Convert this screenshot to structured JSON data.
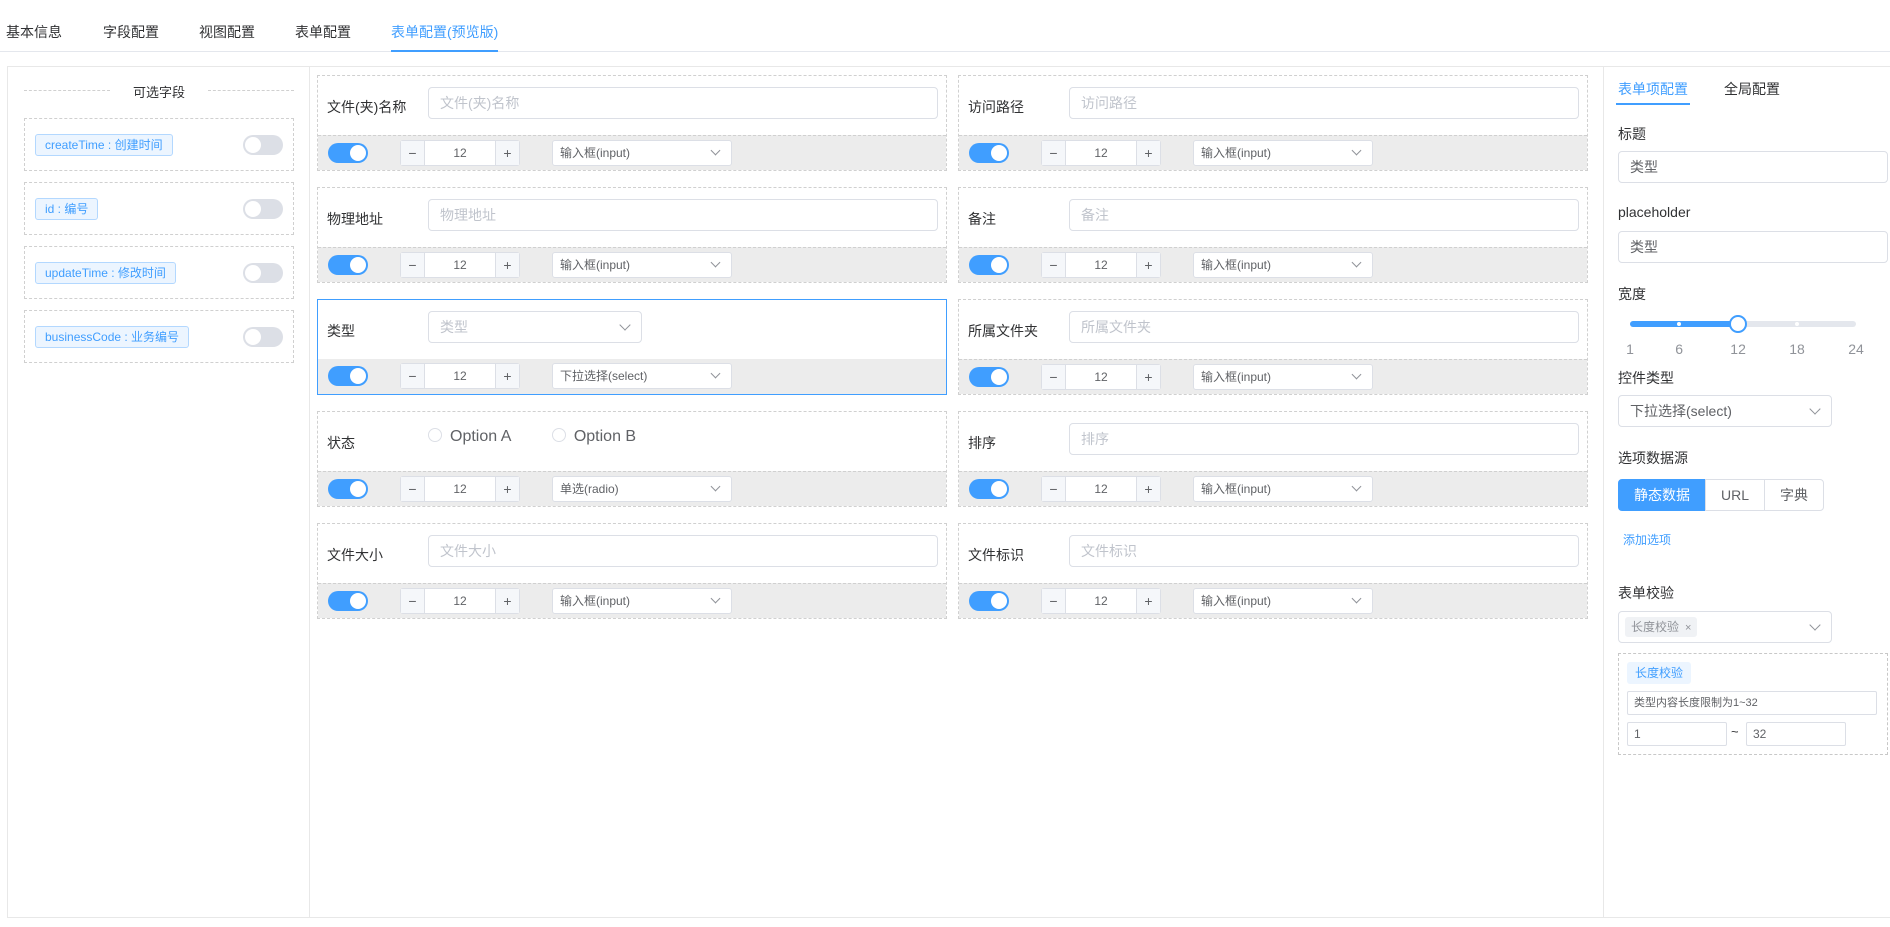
{
  "top_tabs": [
    {
      "label": "基本信息",
      "active": false
    },
    {
      "label": "字段配置",
      "active": false
    },
    {
      "label": "视图配置",
      "active": false
    },
    {
      "label": "表单配置",
      "active": false
    },
    {
      "label": "表单配置(预览版)",
      "active": true
    }
  ],
  "left_panel": {
    "title": "可选字段",
    "fields": [
      {
        "tag": "createTime : 创建时间",
        "enabled": false
      },
      {
        "tag": "id : 编号",
        "enabled": false
      },
      {
        "tag": "updateTime : 修改时间",
        "enabled": false
      },
      {
        "tag": "businessCode : 业务编号",
        "enabled": false
      }
    ]
  },
  "form_items": [
    {
      "label": "文件(夹)名称",
      "placeholder": "文件(夹)名称",
      "width": "12",
      "control": "输入框(input)",
      "enabled": true
    },
    {
      "label": "访问路径",
      "placeholder": "访问路径",
      "width": "12",
      "control": "输入框(input)",
      "enabled": true
    },
    {
      "label": "物理地址",
      "placeholder": "物理地址",
      "width": "12",
      "control": "输入框(input)",
      "enabled": true
    },
    {
      "label": "备注",
      "placeholder": "备注",
      "width": "12",
      "control": "输入框(input)",
      "enabled": true
    },
    {
      "label": "类型",
      "placeholder": "类型",
      "width": "12",
      "control": "下拉选择(select)",
      "enabled": true,
      "selected": true
    },
    {
      "label": "所属文件夹",
      "placeholder": "所属文件夹",
      "width": "12",
      "control": "输入框(input)",
      "enabled": true
    },
    {
      "label": "状态",
      "options": [
        "Option A",
        "Option B"
      ],
      "width": "12",
      "control": "单选(radio)",
      "enabled": true
    },
    {
      "label": "排序",
      "placeholder": "排序",
      "width": "12",
      "control": "输入框(input)",
      "enabled": true
    },
    {
      "label": "文件大小",
      "placeholder": "文件大小",
      "width": "12",
      "control": "输入框(input)",
      "enabled": true
    },
    {
      "label": "文件标识",
      "placeholder": "文件标识",
      "width": "12",
      "control": "输入框(input)",
      "enabled": true
    }
  ],
  "stepper": {
    "minus": "−",
    "plus": "+"
  },
  "right_panel": {
    "tabs": [
      {
        "label": "表单项配置",
        "active": true
      },
      {
        "label": "全局配置",
        "active": false
      }
    ],
    "title_label": "标题",
    "title_value": "类型",
    "placeholder_label": "placeholder",
    "placeholder_value": "类型",
    "width_label": "宽度",
    "width_slider": {
      "min": 1,
      "max": 24,
      "value": 12,
      "marks": [
        "1",
        "6",
        "12",
        "18",
        "24"
      ]
    },
    "control_label": "控件类型",
    "control_value": "下拉选择(select)",
    "datasource_label": "选项数据源",
    "datasource_options": [
      {
        "label": "静态数据",
        "active": true
      },
      {
        "label": "URL",
        "active": false
      },
      {
        "label": "字典",
        "active": false
      }
    ],
    "add_option": "添加选项",
    "validation_label": "表单校验",
    "validation_chip": "长度校验",
    "validation_chip_close": "×",
    "rule": {
      "tag": "长度校验",
      "message": "类型内容长度限制为1~32",
      "min": "1",
      "tilde": "~",
      "max": "32"
    }
  },
  "colors": {
    "accent": "#409eff",
    "bar": "#ececec"
  }
}
